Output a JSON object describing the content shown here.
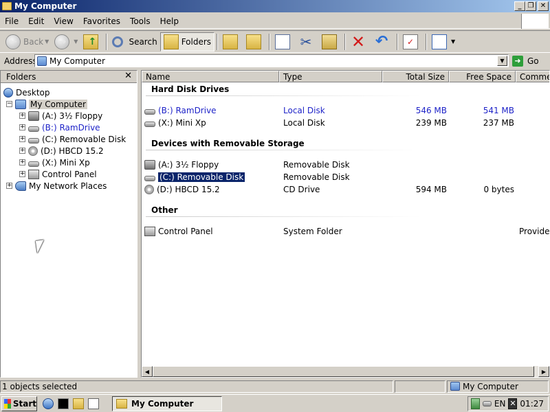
{
  "window": {
    "title": "My Computer"
  },
  "menu": [
    "File",
    "Edit",
    "View",
    "Favorites",
    "Tools",
    "Help"
  ],
  "toolbar": {
    "back": "Back",
    "search": "Search",
    "folders": "Folders"
  },
  "address": {
    "label": "Address",
    "value": "My Computer",
    "go": "Go"
  },
  "folders_pane": {
    "title": "Folders",
    "tree": [
      {
        "label": "Desktop",
        "icon": "desktop-icon"
      },
      {
        "label": "My Computer",
        "icon": "computer-icon"
      },
      {
        "label": "(A:) 3½ Floppy",
        "icon": "floppy-icon"
      },
      {
        "label": "(B:) RamDrive",
        "icon": "drive-icon"
      },
      {
        "label": "(C:) Removable Disk",
        "icon": "drive-icon"
      },
      {
        "label": "(D:) HBCD 15.2",
        "icon": "cd-icon"
      },
      {
        "label": "(X:) Mini Xp",
        "icon": "drive-icon"
      },
      {
        "label": "Control Panel",
        "icon": "control-panel-icon"
      },
      {
        "label": "My Network Places",
        "icon": "network-icon"
      }
    ]
  },
  "list": {
    "columns": [
      "Name",
      "Type",
      "Total Size",
      "Free Space",
      "Comment"
    ],
    "groups": [
      {
        "title": "Hard Disk Drives",
        "rows": [
          {
            "name": "(B:) RamDrive",
            "type": "Local Disk",
            "total": "546 MB",
            "free": "541 MB"
          },
          {
            "name": "(X:) Mini Xp",
            "type": "Local Disk",
            "total": "239 MB",
            "free": "237 MB"
          }
        ]
      },
      {
        "title": "Devices with Removable Storage",
        "rows": [
          {
            "name": "(A:) 3½ Floppy",
            "type": "Removable Disk"
          },
          {
            "name": "(C:) Removable Disk",
            "type": "Removable Disk"
          },
          {
            "name": "(D:) HBCD 15.2",
            "type": "CD Drive",
            "total": "594 MB",
            "free": "0 bytes"
          }
        ]
      },
      {
        "title": "Other",
        "rows": [
          {
            "name": "Control Panel",
            "type": "System Folder",
            "comment": "Provides"
          }
        ]
      }
    ]
  },
  "status": {
    "left": "1 objects selected",
    "right": "My Computer"
  },
  "taskbar": {
    "start": "Start",
    "task": "My Computer",
    "lang": "EN",
    "clock": "01:27"
  },
  "colors": {
    "title_start": "#0a246a",
    "title_end": "#a6caf0",
    "link_blue": "#1e23c8",
    "selection": "#0a246a"
  }
}
